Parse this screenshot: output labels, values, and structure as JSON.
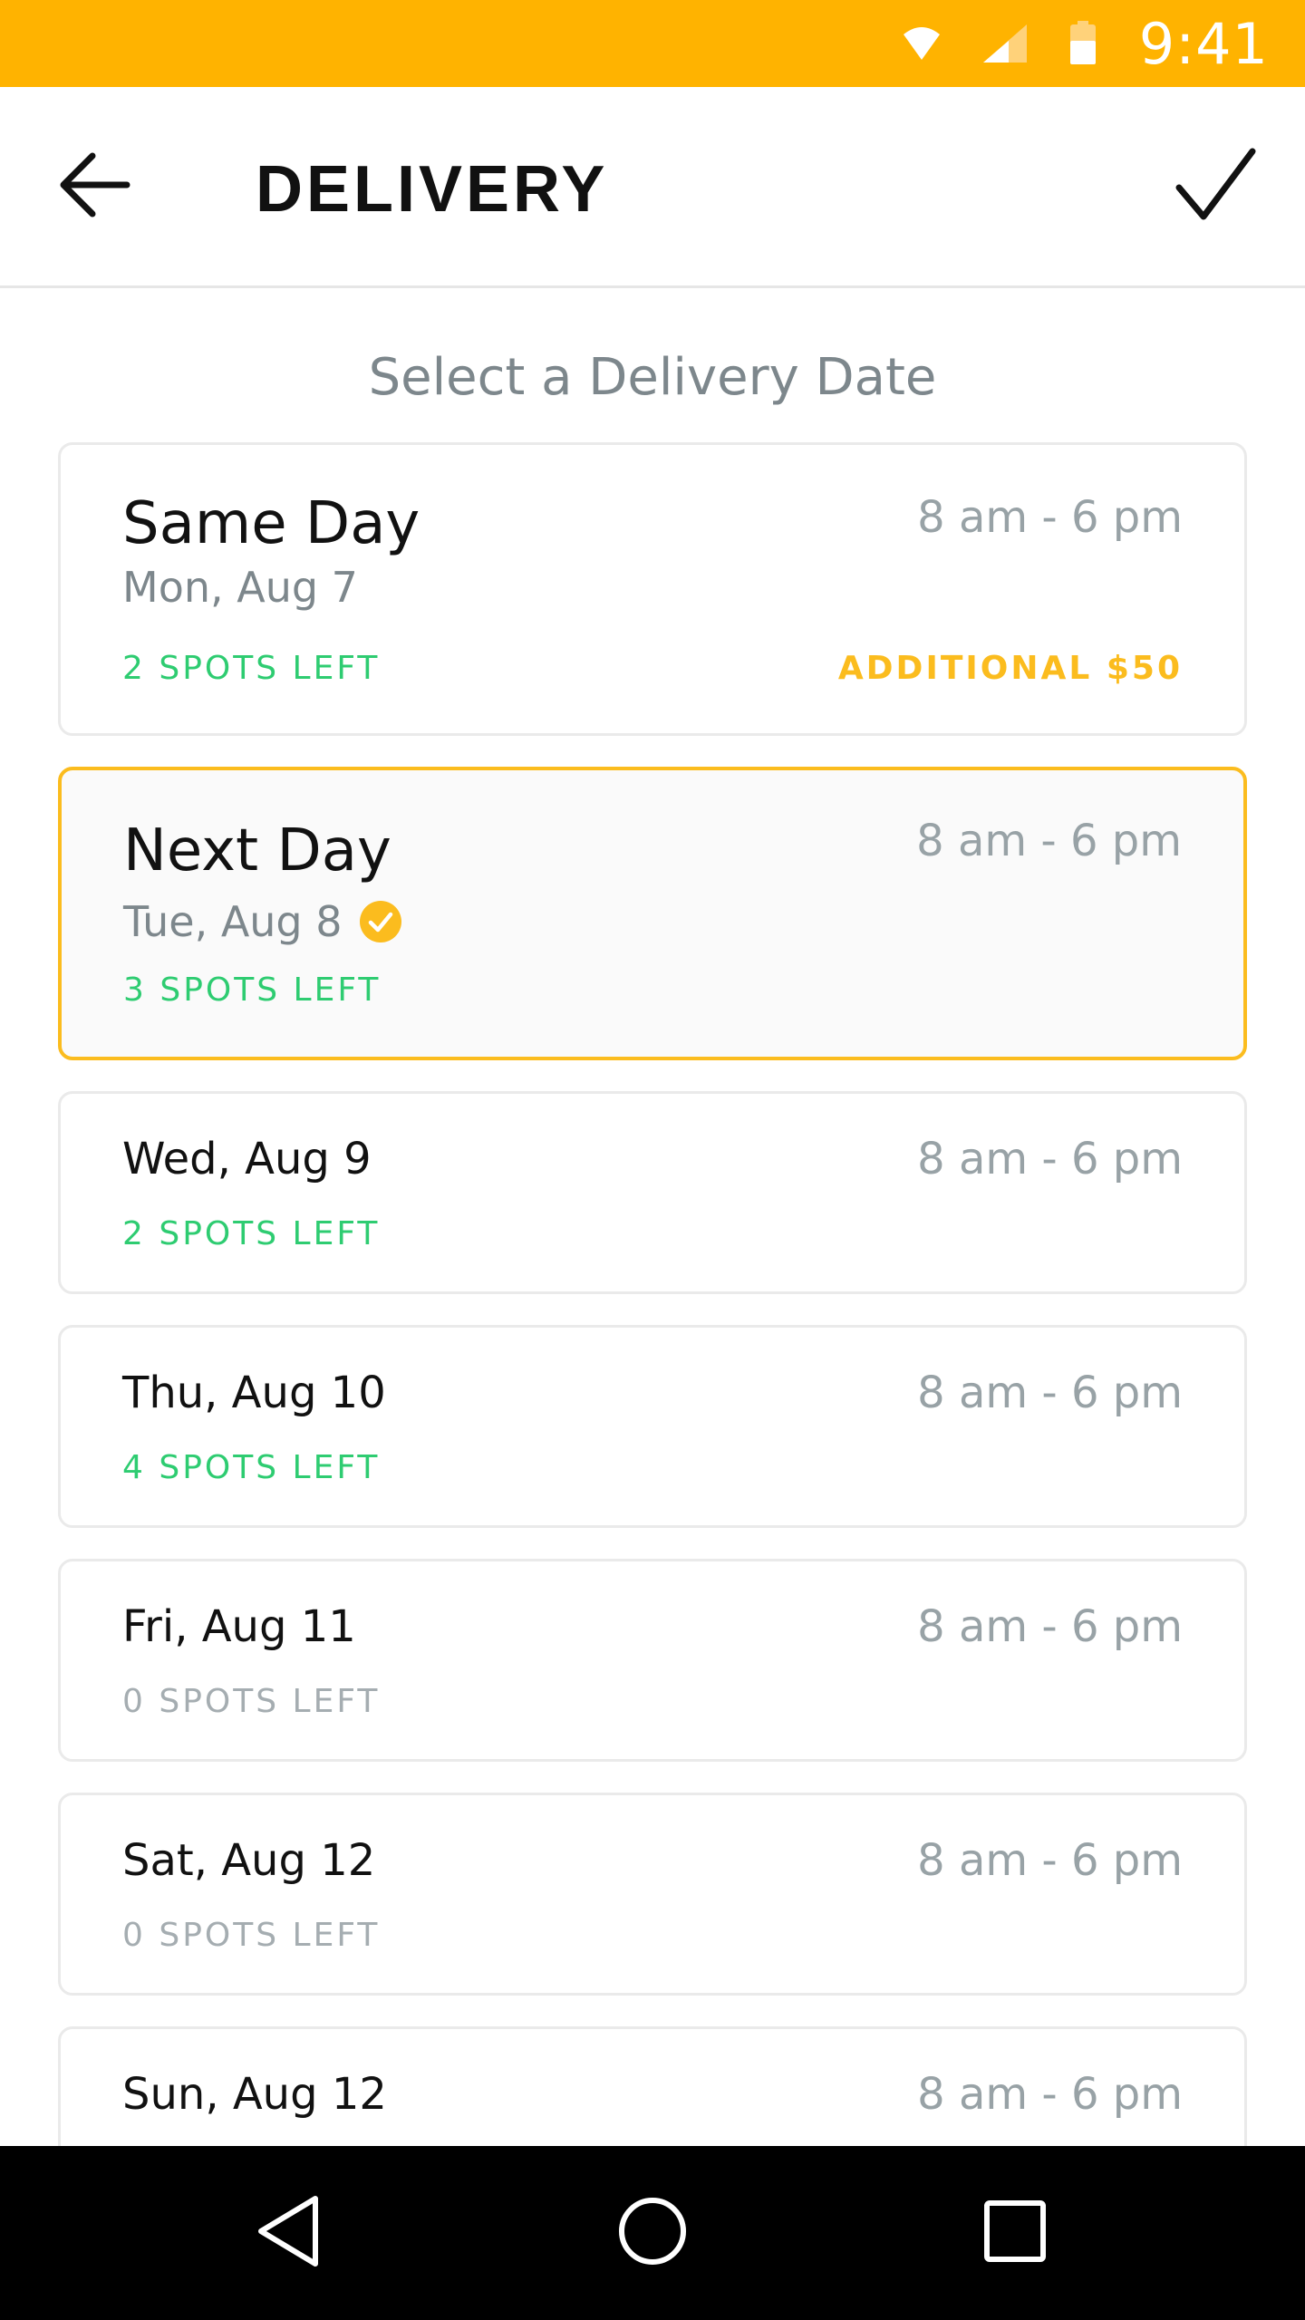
{
  "status_bar": {
    "time": "9:41",
    "icons": [
      "wifi-icon",
      "signal-icon",
      "battery-icon"
    ],
    "color": "#FFB300"
  },
  "app_bar": {
    "title": "DELIVERY",
    "back_icon": "arrow-left-icon",
    "confirm_icon": "check-icon"
  },
  "main": {
    "heading": "Select a Delivery Date",
    "accent_color": "#FBBC1E",
    "available_color": "#2ecc71",
    "options": [
      {
        "label": "Same Day",
        "date": "Mon, Aug 7",
        "time": "8 am - 6 pm",
        "spots": "2 SPOTS LEFT",
        "extra": "ADDITIONAL $50",
        "selected": false
      },
      {
        "label": "Next Day",
        "date": "Tue, Aug 8",
        "time": "8 am - 6 pm",
        "spots": "3 SPOTS LEFT",
        "selected": true
      },
      {
        "label": "Wed, Aug 9",
        "time": "8 am - 6 pm",
        "spots": "2 SPOTS LEFT"
      },
      {
        "label": "Thu, Aug 10",
        "time": "8 am - 6 pm",
        "spots": "4 SPOTS LEFT"
      },
      {
        "label": "Fri, Aug 11",
        "time": "8 am - 6 pm",
        "spots": "0 SPOTS LEFT"
      },
      {
        "label": "Sat, Aug 12",
        "time": "8 am - 6 pm",
        "spots": "0 SPOTS LEFT"
      },
      {
        "label": "Sun, Aug 12",
        "time": "8 am - 6 pm"
      }
    ]
  },
  "nav_bar": {
    "buttons": [
      "back-triangle-icon",
      "home-circle-icon",
      "recents-square-icon"
    ]
  }
}
